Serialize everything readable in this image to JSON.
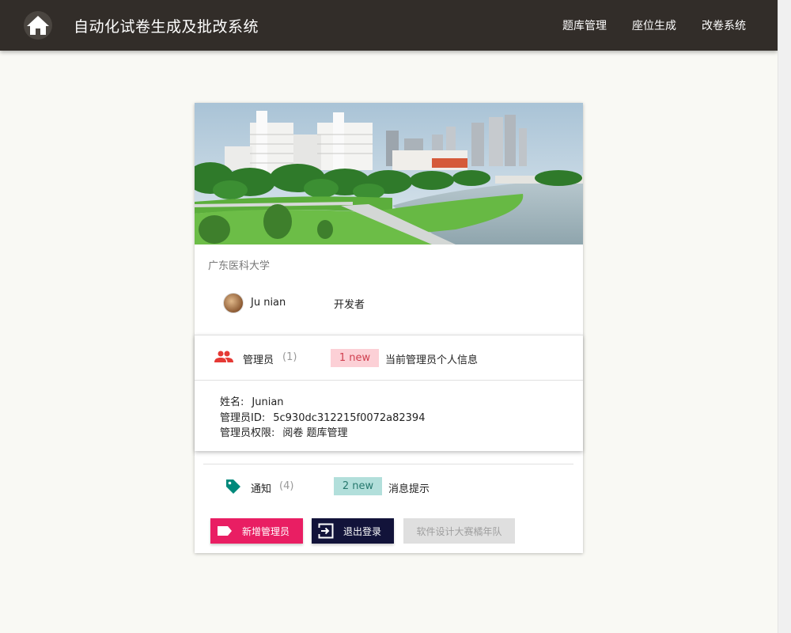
{
  "navbar": {
    "home_icon": "home-icon",
    "title": "自动化试卷生成及批改系统",
    "links": [
      "题库管理",
      "座位生成",
      "改卷系统"
    ]
  },
  "card": {
    "school": "广东医科大学",
    "author": {
      "name": "Ju nian",
      "role": "开发者"
    },
    "admin": {
      "title": "管理员",
      "count": "(1)",
      "badge": "1 new",
      "description": "当前管理员个人信息",
      "info": [
        {
          "label": "姓名:",
          "value": "Junian"
        },
        {
          "label": "管理员ID:",
          "value": "5c930dc312215f0072a82394"
        },
        {
          "label": "管理员权限:",
          "value": "阅卷 题库管理"
        }
      ]
    },
    "notice": {
      "title": "通知",
      "count": "(4)",
      "badge": "2 new",
      "description": "消息提示"
    },
    "buttons": {
      "add": "新增管理员",
      "logout": "退出登录",
      "team": "软件设计大赛橘年队"
    }
  },
  "colors": {
    "navbar": "#322d29",
    "pink_button": "#e91e63",
    "navy_button": "#12133a",
    "pink_badge": "#fcd0d6",
    "teal_badge": "#b2dfdb",
    "people_icon": "#e53935",
    "tag_icon": "#00897b"
  }
}
